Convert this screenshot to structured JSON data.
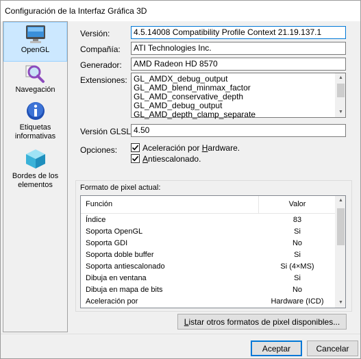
{
  "window": {
    "title": "Configuración de la Interfaz Gráfica 3D"
  },
  "sidebar": {
    "items": [
      {
        "label": "OpenGL",
        "icon": "monitor-icon",
        "selected": true
      },
      {
        "label": "Navegación",
        "icon": "magnifier-icon"
      },
      {
        "label": "Etiquetas informativas",
        "icon": "info-icon"
      },
      {
        "label": "Bordes de los elementos",
        "icon": "cube-icon"
      }
    ]
  },
  "info": {
    "version_label": "Versión:",
    "version_value": "4.5.14008 Compatibility Profile Context 21.19.137.1",
    "company_label": "Compañía:",
    "company_value": "ATI Technologies Inc.",
    "renderer_label": "Generador:",
    "renderer_value": "AMD Radeon HD 8570",
    "extensions_label": "Extensiones:",
    "extensions": [
      "GL_AMDX_debug_output",
      "GL_AMD_blend_minmax_factor",
      "GL_AMD_conservative_depth",
      "GL_AMD_debug_output",
      "GL_AMD_depth_clamp_separate"
    ],
    "glsl_label": "Versión GLSL:",
    "glsl_value": "4.50",
    "options_label": "Opciones:",
    "hw_accel": {
      "pre": "Aceleración por ",
      "key": "H",
      "post": "ardware.",
      "checked": true
    },
    "antialias": {
      "pre": "",
      "key": "A",
      "post": "ntiescalonado.",
      "checked": true
    }
  },
  "pixel_format": {
    "group_label": "Formato de pixel actual:",
    "col_function": "Función",
    "col_value": "Valor",
    "rows": [
      {
        "f": "Índice",
        "v": "83"
      },
      {
        "f": "Soporta OpenGL",
        "v": "Si"
      },
      {
        "f": "Soporta GDI",
        "v": "No"
      },
      {
        "f": "Soporta doble buffer",
        "v": "Si"
      },
      {
        "f": "Soporta antiescalonado",
        "v": "Si (4×MS)"
      },
      {
        "f": "Dibuja en ventana",
        "v": "Si"
      },
      {
        "f": "Dibuja en mapa de bits",
        "v": "No"
      },
      {
        "f": "Aceleración por",
        "v": "Hardware (ICD)"
      }
    ],
    "list_button": {
      "key": "L",
      "post": "istar otros formatos de pixel disponibles..."
    }
  },
  "buttons": {
    "ok": "Aceptar",
    "cancel": "Cancelar"
  },
  "colors": {
    "selection": "#cce8ff",
    "accent": "#0078d7"
  }
}
